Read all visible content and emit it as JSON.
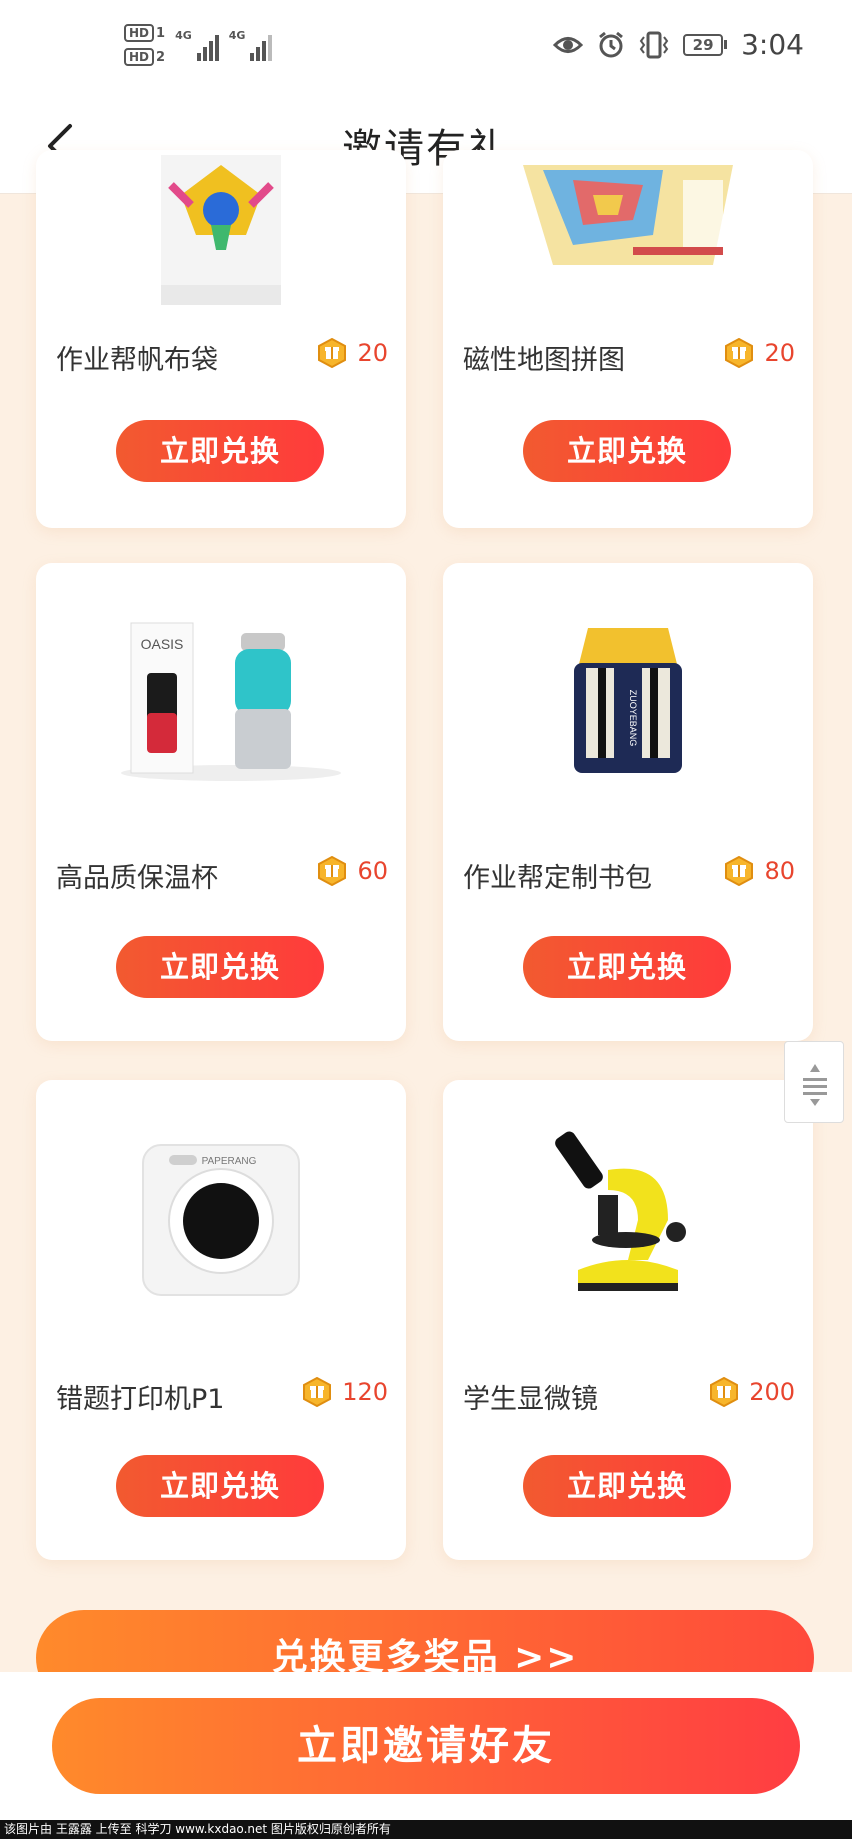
{
  "status_bar": {
    "sim1_label": "HD",
    "sim1_index": "1",
    "sim2_label": "HD",
    "sim2_index": "2",
    "net1": "4G",
    "net2": "4G",
    "battery": "29",
    "time": "3:04"
  },
  "header": {
    "title": "邀请有礼"
  },
  "products": [
    {
      "name": "作业帮帆布袋",
      "price": "20",
      "button": "立即兑换",
      "image": "canvas-bag"
    },
    {
      "name": "磁性地图拼图",
      "price": "20",
      "button": "立即兑换",
      "image": "map-puzzle"
    },
    {
      "name": "高品质保温杯",
      "price": "60",
      "button": "立即兑换",
      "image": "thermos-cup",
      "image_text": "OASIS"
    },
    {
      "name": "作业帮定制书包",
      "price": "80",
      "button": "立即兑换",
      "image": "backpack",
      "image_text": "ZUOYEBANG"
    },
    {
      "name": "错题打印机P1",
      "price": "120",
      "button": "立即兑换",
      "image": "mini-printer",
      "image_text": "PAPERANG"
    },
    {
      "name": "学生显微镜",
      "price": "200",
      "button": "立即兑换",
      "image": "microscope"
    }
  ],
  "more_button": "兑换更多奖品 >>",
  "invite_button": "立即邀请好友",
  "footer_text": "该图片由 王露露 上传至 科学刀 www.kxdao.net 图片版权归原创者所有",
  "colors": {
    "accent_red": "#e8452e",
    "button_gradient_start": "#f25a30",
    "button_gradient_end": "#ff3b3b",
    "page_background": "#fdf0e3"
  }
}
